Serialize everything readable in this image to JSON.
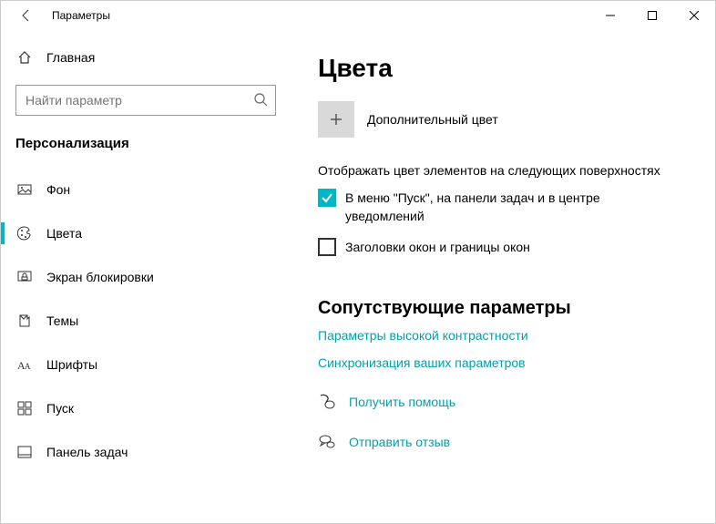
{
  "window": {
    "title": "Параметры"
  },
  "sidebar": {
    "home": "Главная",
    "search_placeholder": "Найти параметр",
    "section": "Персонализация",
    "items": [
      {
        "label": "Фон"
      },
      {
        "label": "Цвета"
      },
      {
        "label": "Экран блокировки"
      },
      {
        "label": "Темы"
      },
      {
        "label": "Шрифты"
      },
      {
        "label": "Пуск"
      },
      {
        "label": "Панель задач"
      }
    ]
  },
  "main": {
    "title": "Цвета",
    "custom_color": "Дополнительный цвет",
    "surfaces_heading": "Отображать цвет элементов на следующих поверхностях",
    "checkbox1": "В меню \"Пуск\", на панели задач и в центре уведомлений",
    "checkbox2": "Заголовки окон и границы окон",
    "related_heading": "Сопутствующие параметры",
    "link1": "Параметры высокой контрастности",
    "link2": "Синхронизация ваших параметров",
    "help": "Получить помощь",
    "feedback": "Отправить отзыв"
  },
  "colors": {
    "accent": "#00b7c3"
  }
}
